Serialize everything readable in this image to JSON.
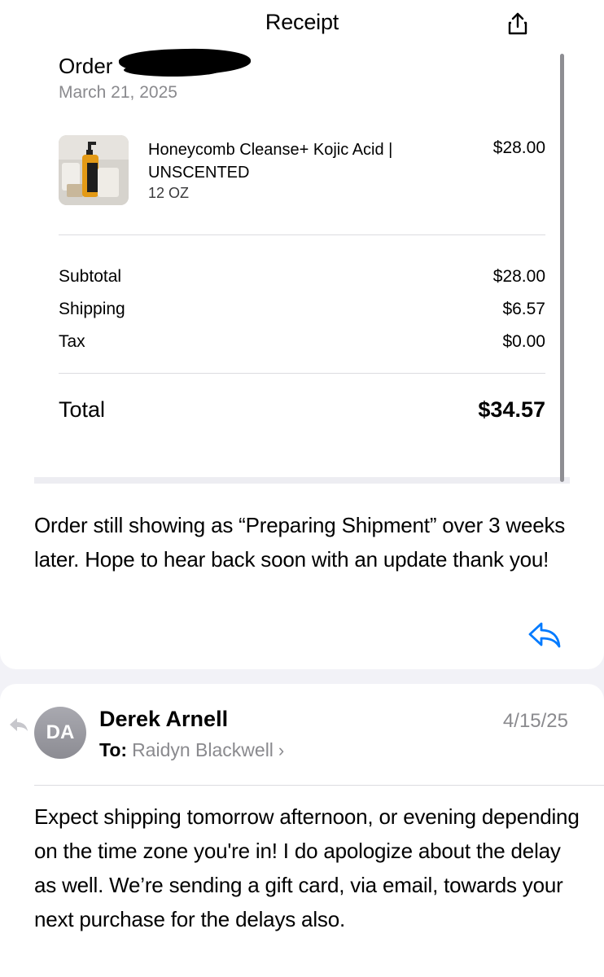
{
  "header": {
    "title": "Receipt",
    "share_icon": "share-icon"
  },
  "receipt": {
    "order_label": "Order",
    "order_date": "March 21, 2025",
    "item": {
      "name": "Honeycomb Cleanse+ Kojic Acid | UNSCENTED",
      "size": "12 OZ",
      "price": "$28.00"
    },
    "subtotal_label": "Subtotal",
    "subtotal_value": "$28.00",
    "shipping_label": "Shipping",
    "shipping_value": "$6.57",
    "tax_label": "Tax",
    "tax_value": "$0.00",
    "total_label": "Total",
    "total_value": "$34.57"
  },
  "message1": {
    "body": "Order still showing as “Preparing Shipment” over 3 weeks later. Hope to hear back soon with an update thank you!",
    "reply_icon": "reply-icon"
  },
  "email2": {
    "avatar_initials": "DA",
    "sender": "Derek Arnell",
    "to_label": "To:",
    "to_name": "Raidyn Blackwell",
    "chevron": "›",
    "date": "4/15/25",
    "body": "Expect shipping tomorrow afternoon, or evening depending on the time zone you're in! I do apologize about the delay as well. We’re sending a gift card, via email, towards your next purchase for the delays also."
  },
  "colors": {
    "accent": "#007aff",
    "secondary_text": "#8a8a8e",
    "background": "#f2f2f7"
  }
}
